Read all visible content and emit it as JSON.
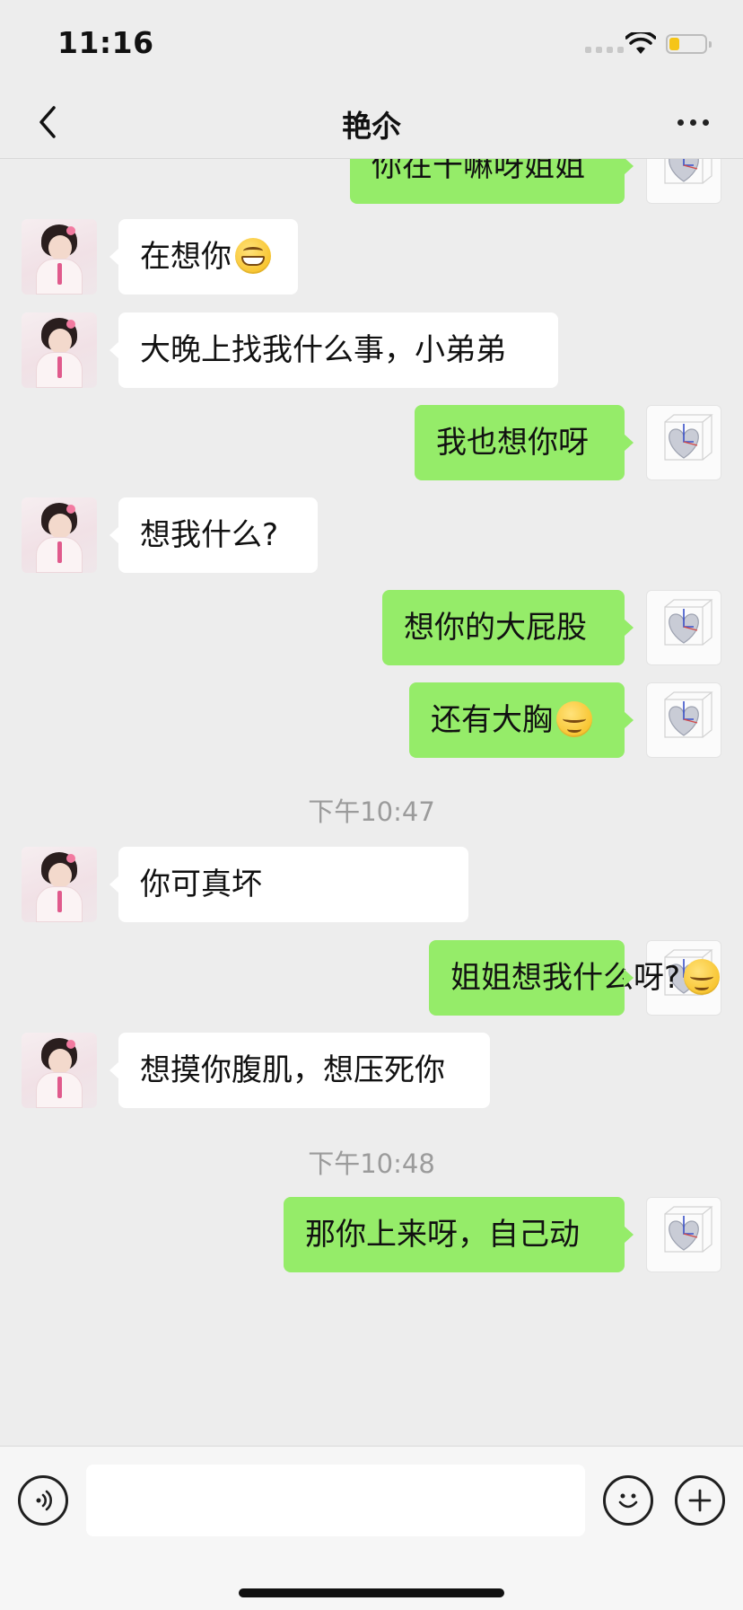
{
  "status_bar": {
    "time": "11:16",
    "battery_level": 0.3
  },
  "nav": {
    "title": "艳尒",
    "back_icon": "chevron-left-icon",
    "more_icon": "ellipsis-icon"
  },
  "messages": [
    {
      "type": "message",
      "side": "out",
      "text": "你在干嘛呀姐姐"
    },
    {
      "type": "message",
      "side": "in",
      "text": "在想你",
      "emoji": "grin-emoji"
    },
    {
      "type": "message",
      "side": "in",
      "text": "大晚上找我什么事，小弟弟"
    },
    {
      "type": "message",
      "side": "out",
      "text": "我也想你呀"
    },
    {
      "type": "message",
      "side": "in",
      "text": "想我什么?"
    },
    {
      "type": "message",
      "side": "out",
      "text": "想你的大屁股"
    },
    {
      "type": "message",
      "side": "out",
      "text": "还有大胸",
      "emoji": "shy-smile-emoji"
    },
    {
      "type": "timestamp",
      "text": "下午10:47"
    },
    {
      "type": "message",
      "side": "in",
      "text": "你可真坏"
    },
    {
      "type": "message",
      "side": "out",
      "text": "姐姐想我什么呀?",
      "emoji": "shy-smile-emoji"
    },
    {
      "type": "message",
      "side": "in",
      "text": "想摸你腹肌，想压死你"
    },
    {
      "type": "timestamp",
      "text": "下午10:48"
    },
    {
      "type": "message",
      "side": "out",
      "text": "那你上来呀，自己动"
    }
  ],
  "input_bar": {
    "voice_icon": "voice-icon",
    "input_value": "",
    "emoji_icon": "smiley-icon",
    "plus_icon": "plus-icon"
  },
  "colors": {
    "background": "#ededed",
    "outgoing_bubble": "#95ec69",
    "incoming_bubble": "#ffffff",
    "timestamp": "#9b9b9b"
  }
}
